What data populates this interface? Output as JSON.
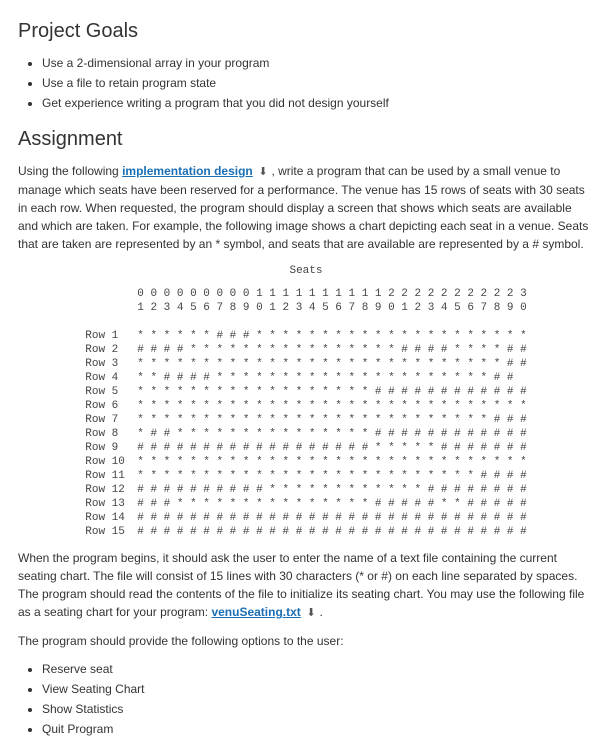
{
  "headings": {
    "project_goals": "Project Goals",
    "assignment": "Assignment"
  },
  "goals": [
    "Use a 2-dimensional array in your program",
    "Use a file to retain program state",
    "Get experience writing a program that you did not design yourself"
  ],
  "para1_pre": "Using the following ",
  "link1_text": "implementation design",
  "para1_post": " , write a program that can be used by a small venue to manage which seats have been reserved for a performance. The venue has 15 rows of seats with 30 seats in each row. When requested, the program should display a screen that shows which seats are available and which are taken. For example, the following image shows a chart depicting each seat in a venue. Seats that are taken are represented by an * symbol, and seats that are available are represented by a # symbol.",
  "seating": {
    "title": "Seats",
    "header_tens": "0 0 0 0 0 0 0 0 0 1 1 1 1 1 1 1 1 1 1 2 2 2 2 2 2 2 2 2 2 3",
    "header_ones": "1 2 3 4 5 6 7 8 9 0 1 2 3 4 5 6 7 8 9 0 1 2 3 4 5 6 7 8 9 0",
    "rows": [
      {
        "label": "Row 1",
        "seats": "* * * * * * # # # * * * * * * * * * * * * * * * * * * * * *"
      },
      {
        "label": "Row 2",
        "seats": "# # # # * * * * * * * * * * * * * * * * # # # # * * * * # #"
      },
      {
        "label": "Row 3",
        "seats": "* * * * * * * * * * * * * * * * * * * * * * * * * * * * # #"
      },
      {
        "label": "Row 4",
        "seats": "* * # # # # * * * * * * * * * * * * * * * * * * * * * # #"
      },
      {
        "label": "Row 5",
        "seats": "* * * * * * * * * * * * * * * * * * # # # # # # # # # # # #"
      },
      {
        "label": "Row 6",
        "seats": "* * * * * * * * * * * * * * * * * * * * * * * * * * * * * *"
      },
      {
        "label": "Row 7",
        "seats": "* * * * * * * * * * * * * * * * * * * * * * * * * * * # # #"
      },
      {
        "label": "Row 8",
        "seats": "* # # * * * * * * * * * * * * * * * # # # # # # # # # # # #"
      },
      {
        "label": "Row 9",
        "seats": "# # # # # # # # # # # # # # # # # # * * * * * # # # # # # #"
      },
      {
        "label": "Row 10",
        "seats": "* * * * * * * * * * * * * * * * * * * * * * * * * * * * * *"
      },
      {
        "label": "Row 11",
        "seats": "* * * * * * * * * * * * * * * * * * * * * * * * * * # # # #"
      },
      {
        "label": "Row 12",
        "seats": "# # # # # # # # # # * * * * * * * * * * * * # # # # # # # #"
      },
      {
        "label": "Row 13",
        "seats": "# # # * * * * * * * * * * * * * * * # # # # # * * # # # # #"
      },
      {
        "label": "Row 14",
        "seats": "# # # # # # # # # # # # # # # # # # # # # # # # # # # # # #"
      },
      {
        "label": "Row 15",
        "seats": "# # # # # # # # # # # # # # # # # # # # # # # # # # # # # #"
      }
    ]
  },
  "para2_pre": "When the program begins, it should ask the user to enter the name of a text file containing the current seating chart.  The file will consist of 15 lines with 30 characters (* or #) on each line separated by spaces. The program should read the contents of the file to initialize its seating chart. You may use the following file as a seating chart for your program: ",
  "link2_text": "venuSeating.txt",
  "para2_post": " .",
  "para3": "The program should provide the following options to the user:",
  "options": [
    "Reserve seat",
    "View Seating Chart",
    "Show Statistics",
    "Quit Program"
  ]
}
